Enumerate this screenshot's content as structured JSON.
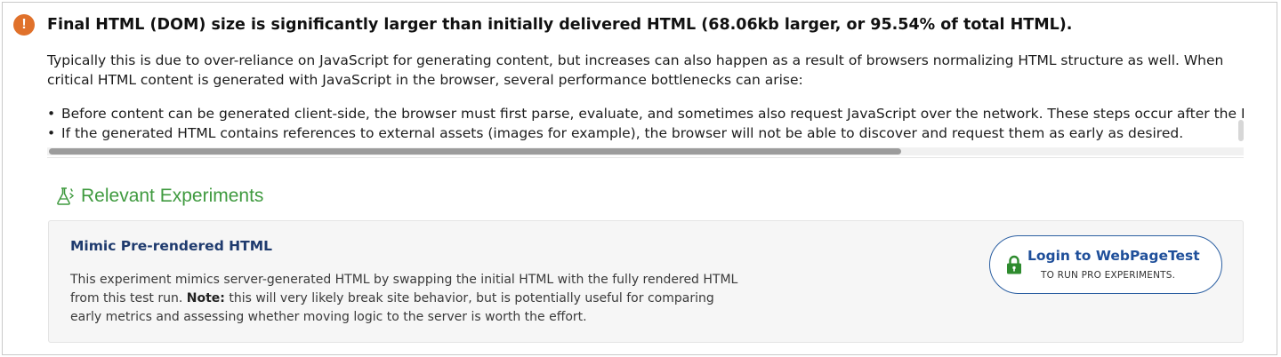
{
  "alert": {
    "icon": "exclamation-icon",
    "icon_glyph": "!",
    "icon_color": "#e0712b",
    "heading": "Final HTML (DOM) size is significantly larger than initially delivered HTML (68.06kb larger, or 95.54% of total HTML).",
    "paragraph": "Typically this is due to over-reliance on JavaScript for generating content, but increases can also happen as a result of browsers normalizing HTML structure as well. When critical HTML content is generated with JavaScript in the browser, several performance bottlenecks can arise:",
    "bullets": [
      "Before content can be generated client-side, the browser must first parse, evaluate, and sometimes also request JavaScript over the network. These steps occur after the HTML is",
      "If the generated HTML contains references to external assets (images for example), the browser will not be able to discover and request them as early as desired."
    ],
    "bullet_glyph": "•"
  },
  "experiments": {
    "section_title": "Relevant Experiments",
    "section_icon": "flask-icon",
    "accent_color": "#3f9a3f",
    "card": {
      "title": "Mimic Pre-rendered HTML",
      "desc_before": "This experiment mimics server-generated HTML by swapping the initial HTML with the fully rendered HTML from this test run. ",
      "desc_note_label": "Note:",
      "desc_after": " this will very likely break site behavior, but is potentially useful for comparing early metrics and assessing whether moving logic to the server is worth the effort."
    },
    "login_button": {
      "label": "Login to WebPageTest",
      "sublabel": "TO RUN PRO EXPERIMENTS.",
      "icon": "lock-icon",
      "color": "#1f4f9a",
      "lock_color": "#2e8b2e"
    }
  }
}
